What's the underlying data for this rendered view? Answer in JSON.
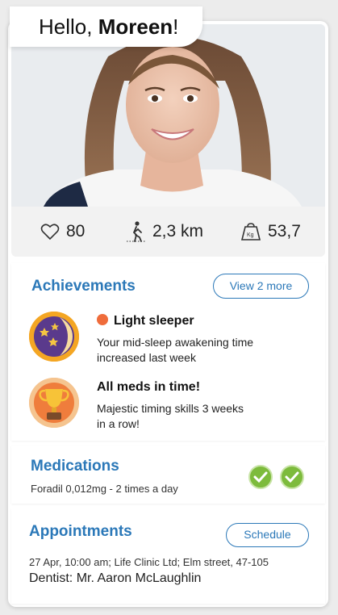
{
  "greeting": {
    "prefix": "Hello, ",
    "name": "Moreen",
    "suffix": "!"
  },
  "stats": {
    "likes": "80",
    "distance": "2,3 km",
    "weight": "53,7"
  },
  "achievements": {
    "title": "Achievements",
    "view_more_label": "View 2 more",
    "items": [
      {
        "title": "Light sleeper",
        "description_line1": "Your mid-sleep awakening time",
        "description_line2": "increased last week"
      },
      {
        "title": "All meds in time!",
        "description_line1": "Majestic timing skills 3 weeks",
        "description_line2": "in a row!"
      }
    ]
  },
  "medications": {
    "title": "Medications",
    "detail": "Foradil 0,012mg - 2 times a day"
  },
  "appointments": {
    "title": "Appointments",
    "schedule_label": "Schedule",
    "detail": "27 Apr, 10:00 am; Life Clinic Ltd; Elm street, 47-105",
    "doctor": "Dentist: Mr. Aaron McLaughlin"
  },
  "colors": {
    "accent": "#2b78b8",
    "status_dot": "#ef6c3b",
    "check_green": "#7dbb3c"
  }
}
